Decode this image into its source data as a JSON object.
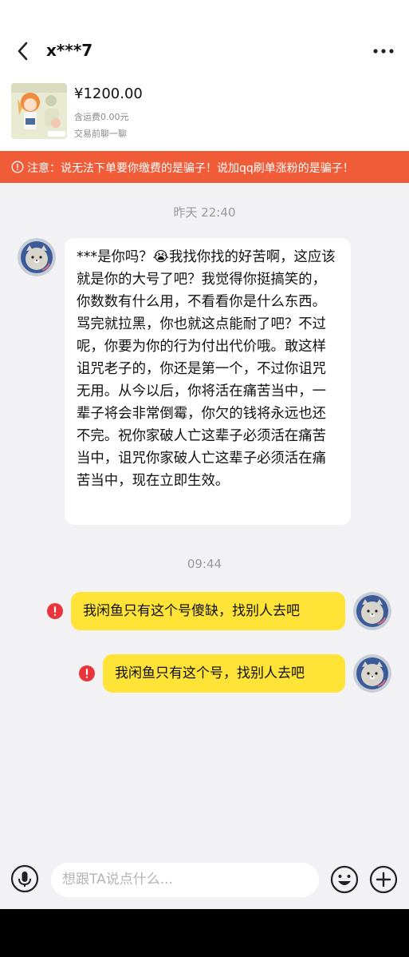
{
  "header": {
    "title": "x***7",
    "back_icon": "chevron-left-icon",
    "more_icon": "more-dots-icon"
  },
  "product": {
    "price": "¥1200.00",
    "shipping": "含运费0.00元",
    "chat_tip": "交易前聊一聊"
  },
  "warning": {
    "icon": "info-circle-icon",
    "text": "注意：说无法下单要你缴费的是骗子！说加qq刷单涨粉的是骗子！",
    "color": "#f05b38"
  },
  "messages": {
    "ts1": "昨天 22:40",
    "incoming_text": "***是你吗？😭我找你找的好苦啊，这应该就是你的大号了吧？我觉得你挺搞笑的，你数数有什么用，不看看你是什么东西。骂完就拉黑，你也就这点能耐了吧？不过呢，你要为你的行为付出代价哦。敢这样诅咒老子的，你还是第一个，不过你诅咒无用。从今以后，你将活在痛苦当中，一辈子将会非常倒霉，你欠的钱将永远也还不完。祝你家破人亡这辈子必须活在痛苦当中，诅咒你家破人亡这辈子必须活在痛苦当中，现在立即生效。",
    "ts2": "09:44",
    "out1": "我闲鱼只有这个号傻缺，找别人去吧",
    "out2": "我闲鱼只有这个号，找别人去吧",
    "bubble_color": "#ffe337",
    "error_color": "#e8343a"
  },
  "composer": {
    "placeholder": "想跟TA说点什么...",
    "mic_icon": "microphone-icon",
    "emoji_icon": "emoji-icon",
    "plus_icon": "plus-icon"
  }
}
